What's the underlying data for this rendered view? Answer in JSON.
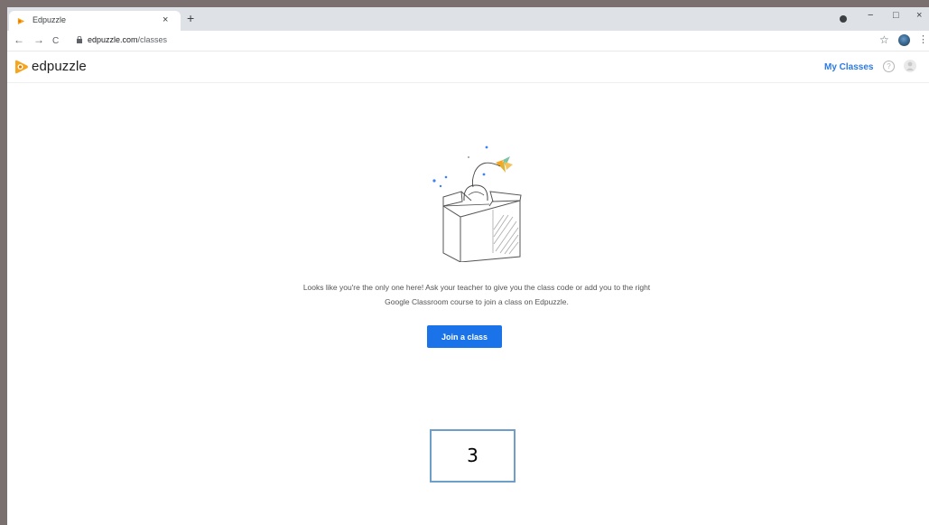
{
  "browser": {
    "tab_title": "Edpuzzle",
    "tab_close": "×",
    "new_tab": "+",
    "back": "←",
    "forward": "→",
    "reload": "C",
    "url_host": "edpuzzle.com",
    "url_path": "/classes",
    "bookmark": "☆",
    "menu": "⋮",
    "window_minimize": "−",
    "window_maximize": "□",
    "window_close": "×"
  },
  "header": {
    "logo_text": "edpuzzle",
    "nav_link": "My Classes",
    "help": "?"
  },
  "main": {
    "message_line1": "Looks like you're the only one here! Ask your teacher to give you the class code or add you to the right",
    "message_line2": "Google Classroom course to join a class on Edpuzzle.",
    "join_button": "Join a class"
  },
  "overlay": {
    "step_number": "3"
  },
  "colors": {
    "brand_orange": "#f7a51c",
    "link_blue": "#2a7ae2",
    "button_blue": "#1a73e8"
  },
  "icons": [
    "edpuzzle-logo-icon",
    "help-icon",
    "avatar-icon",
    "star-icon",
    "lock-icon",
    "account-icon"
  ]
}
